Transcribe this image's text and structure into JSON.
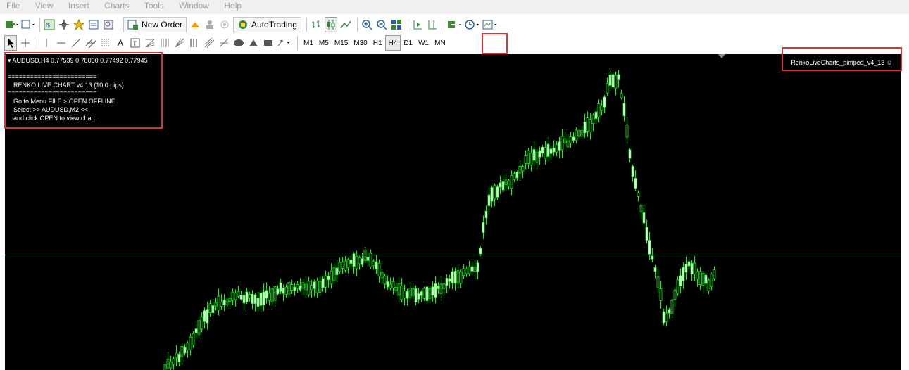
{
  "menu": [
    "File",
    "View",
    "Insert",
    "Charts",
    "Tools",
    "Window",
    "Help"
  ],
  "toolbar": {
    "new_order_label": "New Order",
    "autotrading_label": "AutoTrading",
    "timeframes": [
      "M1",
      "M5",
      "M15",
      "M30",
      "H1",
      "H4",
      "D1",
      "W1",
      "MN"
    ],
    "active_timeframe": "H4"
  },
  "chart": {
    "header": "▾ AUDUSD,H4  0.77539 0.78060 0.77492 0.77945",
    "info_lines": [
      "========================",
      "RENKO LIVE CHART v4.13 (10.0 pips)",
      "========================",
      "Go to Menu FILE > OPEN OFFLINE",
      "Select >> AUDUSD,M2 <<",
      "and click OPEN to view chart."
    ],
    "indicator_label": "RenkoLiveCharts_pimped_v4_13 ☺",
    "colors": {
      "background": "#000000",
      "candle": "#00ff00",
      "bull_body": "#ffffff",
      "price_line": "#4f8c6f",
      "highlight": "#e23030"
    }
  }
}
